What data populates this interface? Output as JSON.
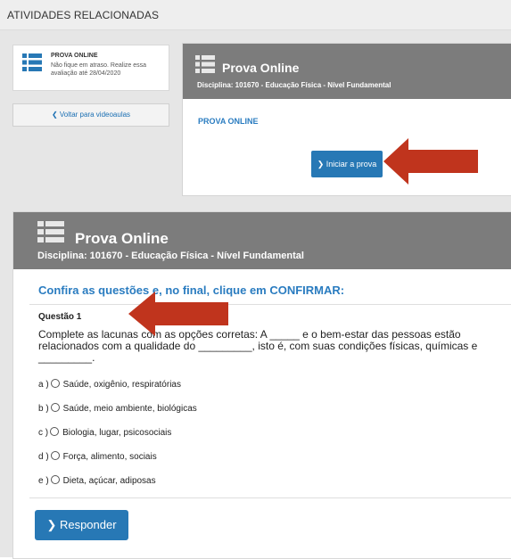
{
  "section_title": "ATIVIDADES RELACIONADAS",
  "side_card": {
    "icon": "list-icon",
    "title": "PROVA ONLINE",
    "text": "Não fique em atraso. Realize essa avaliação até 28/04/2020"
  },
  "back_button": {
    "label": "Voltar para videoaulas"
  },
  "prova_card": {
    "title": "Prova Online",
    "discipline": "Disciplina: 101670 - Educação Física - Nível Fundamental",
    "label": "PROVA ONLINE",
    "start_button": "Iniciar a prova"
  },
  "main": {
    "title": "Prova Online",
    "discipline": "Disciplina: 101670 - Educação Física - Nível Fundamental",
    "confirm_text": "Confira as questões e, no final, clique em CONFIRMAR:",
    "question_number": "Questão 1",
    "question_text": "Complete as lacunas com as opções corretas: A _____ e o bem-estar das pessoas estão relacionados com a qualidade do _________, isto é, com suas condições físicas, químicas e _________.",
    "options": [
      {
        "letter": "a )",
        "text": "Saúde, oxigênio, respiratórias"
      },
      {
        "letter": "b )",
        "text": "Saúde, meio ambiente, biológicas"
      },
      {
        "letter": "c )",
        "text": "Biologia, lugar, psicosociais"
      },
      {
        "letter": "d )",
        "text": "Força, alimento, sociais"
      },
      {
        "letter": "e )",
        "text": "Dieta, açúcar, adiposas"
      }
    ],
    "answer_button": "Responder"
  },
  "colors": {
    "accent_blue": "#2778b5",
    "header_gray": "#7c7c7c",
    "arrow_red": "#c0341d"
  }
}
